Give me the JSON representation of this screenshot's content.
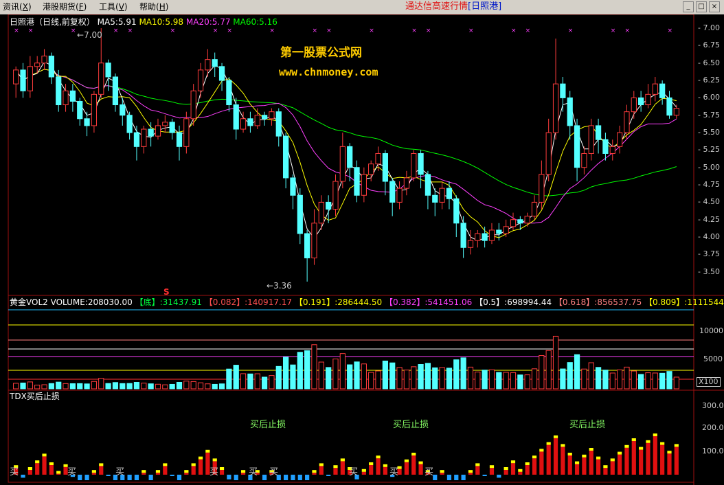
{
  "menu": {
    "items": [
      {
        "label": "资讯",
        "key": "X"
      },
      {
        "label": "港股期货",
        "key": "F"
      },
      {
        "label": "工具",
        "key": "V"
      },
      {
        "label": "帮助",
        "key": "H"
      }
    ],
    "title_red": "通达信高速行情",
    "title_blue": "[日照港]"
  },
  "main": {
    "stock_label": "日照港（日线,前复权）",
    "ma5": "MA5:5.91",
    "ma10": "MA10:5.98",
    "ma20": "MA20:5.77",
    "ma60": "MA60:5.16",
    "high_mark": "7.00",
    "low_mark": "3.36",
    "s_marker": "S",
    "watermark_title": "第一股票公式网",
    "watermark_url": "www.chnmoney.com",
    "y_axis": [
      "7.00",
      "6.75",
      "6.50",
      "6.25",
      "6.00",
      "5.75",
      "5.50",
      "5.25",
      "5.00",
      "4.75",
      "4.50",
      "4.25",
      "4.00",
      "3.75",
      "3.50"
    ],
    "y_min": 3.3,
    "y_max": 7.05
  },
  "volume": {
    "name": "黄金VOL2",
    "volume_label": "VOLUME:208030.00",
    "levels": [
      {
        "tag": "【底】",
        "value": ":31437.91",
        "color": "#00ff40"
      },
      {
        "tag": "【0.082】",
        "value": ":140917.17",
        "color": "#ff5050"
      },
      {
        "tag": "【0.191】",
        "value": ":286444.50",
        "color": "#ffff00"
      },
      {
        "tag": "【0.382】",
        "value": ":541451.06",
        "color": "#ff40ff"
      },
      {
        "tag": "【0.5】",
        "value": ":698994.44",
        "color": "#ffffff"
      },
      {
        "tag": "【0.618】",
        "value": ":856537.75",
        "color": "#ff8080"
      },
      {
        "tag": "【0.809】",
        "value": ":1111544.",
        "color": "#ffff00"
      }
    ],
    "y_axis": [
      "10000",
      "5000"
    ],
    "unit": "X100"
  },
  "indicator": {
    "name": "TDX买后止损",
    "y_axis": [
      "300.0",
      "200.0",
      "100.0"
    ],
    "notes": [
      "买后止损",
      "买后止损",
      "买后止损"
    ],
    "buy_label": "买"
  },
  "chart_data": {
    "type": "candlestick",
    "note": "Daily candles, approximate OHLC read from the price axis",
    "ylim": [
      3.3,
      7.05
    ],
    "candles": [
      [
        6.2,
        6.4,
        6.45,
        6.0
      ],
      [
        6.4,
        6.1,
        6.5,
        6.0
      ],
      [
        6.1,
        6.45,
        6.6,
        6.0
      ],
      [
        6.45,
        6.5,
        6.6,
        6.35
      ],
      [
        6.5,
        6.6,
        6.7,
        6.4
      ],
      [
        6.6,
        6.3,
        6.65,
        6.2
      ],
      [
        6.3,
        5.9,
        6.4,
        5.8
      ],
      [
        5.9,
        6.1,
        6.2,
        5.8
      ],
      [
        6.1,
        5.95,
        6.2,
        5.8
      ],
      [
        5.95,
        5.7,
        6.0,
        5.6
      ],
      [
        5.7,
        5.6,
        5.8,
        5.45
      ],
      [
        5.6,
        6.05,
        6.1,
        5.5
      ],
      [
        6.05,
        6.5,
        7.0,
        6.0
      ],
      [
        6.5,
        6.3,
        6.55,
        6.1
      ],
      [
        6.3,
        5.9,
        6.35,
        5.8
      ],
      [
        5.9,
        5.75,
        6.0,
        5.6
      ],
      [
        5.75,
        5.5,
        5.8,
        5.4
      ],
      [
        5.5,
        5.3,
        5.6,
        5.1
      ],
      [
        5.3,
        5.55,
        5.6,
        5.2
      ],
      [
        5.55,
        5.45,
        5.65,
        5.3
      ],
      [
        5.45,
        5.6,
        5.7,
        5.4
      ],
      [
        5.6,
        5.65,
        5.75,
        5.5
      ],
      [
        5.65,
        5.5,
        5.7,
        5.4
      ],
      [
        5.5,
        5.3,
        5.6,
        5.1
      ],
      [
        5.3,
        5.7,
        5.8,
        5.2
      ],
      [
        5.7,
        6.1,
        6.2,
        5.6
      ],
      [
        6.1,
        6.4,
        6.5,
        6.0
      ],
      [
        6.4,
        6.55,
        6.7,
        6.3
      ],
      [
        6.55,
        6.45,
        6.65,
        6.3
      ],
      [
        6.45,
        6.25,
        6.5,
        6.1
      ],
      [
        6.25,
        5.9,
        6.3,
        5.8
      ],
      [
        5.9,
        5.55,
        6.0,
        5.4
      ],
      [
        5.55,
        5.7,
        5.8,
        5.5
      ],
      [
        5.7,
        5.6,
        5.8,
        5.5
      ],
      [
        5.6,
        5.75,
        5.85,
        5.55
      ],
      [
        5.75,
        5.7,
        5.8,
        5.6
      ],
      [
        5.7,
        5.8,
        5.85,
        5.6
      ],
      [
        5.8,
        5.45,
        5.85,
        5.3
      ],
      [
        5.45,
        4.85,
        5.5,
        4.7
      ],
      [
        4.85,
        4.6,
        4.9,
        4.4
      ],
      [
        4.6,
        4.05,
        4.7,
        3.9
      ],
      [
        4.05,
        3.7,
        4.1,
        3.36
      ],
      [
        3.7,
        4.2,
        4.4,
        3.6
      ],
      [
        4.2,
        4.5,
        4.6,
        4.1
      ],
      [
        4.5,
        4.4,
        4.6,
        4.2
      ],
      [
        4.4,
        4.8,
        4.9,
        4.3
      ],
      [
        4.8,
        5.3,
        5.5,
        4.7
      ],
      [
        5.3,
        5.0,
        5.35,
        4.8
      ],
      [
        5.0,
        4.6,
        5.1,
        4.5
      ],
      [
        4.6,
        4.9,
        5.0,
        4.5
      ],
      [
        4.9,
        5.05,
        5.1,
        4.8
      ],
      [
        5.05,
        5.2,
        5.3,
        4.95
      ],
      [
        5.2,
        4.8,
        5.25,
        4.6
      ],
      [
        4.8,
        4.5,
        4.85,
        4.3
      ],
      [
        4.5,
        4.7,
        4.8,
        4.4
      ],
      [
        4.7,
        4.85,
        4.95,
        4.6
      ],
      [
        4.85,
        5.2,
        5.25,
        4.8
      ],
      [
        5.2,
        4.9,
        5.25,
        4.7
      ],
      [
        4.9,
        4.6,
        4.95,
        4.4
      ],
      [
        4.6,
        4.5,
        4.7,
        4.3
      ],
      [
        4.5,
        4.7,
        4.8,
        4.4
      ],
      [
        4.7,
        4.55,
        4.8,
        4.4
      ],
      [
        4.55,
        4.2,
        4.6,
        4.0
      ],
      [
        4.2,
        3.85,
        4.3,
        3.7
      ],
      [
        3.85,
        3.95,
        4.1,
        3.75
      ],
      [
        3.95,
        4.05,
        4.1,
        3.85
      ],
      [
        4.05,
        3.95,
        4.15,
        3.85
      ],
      [
        3.95,
        4.1,
        4.2,
        3.9
      ],
      [
        4.1,
        4.05,
        4.2,
        3.95
      ],
      [
        4.05,
        4.15,
        4.25,
        4.0
      ],
      [
        4.15,
        4.25,
        4.35,
        4.1
      ],
      [
        4.25,
        4.2,
        4.3,
        4.1
      ],
      [
        4.2,
        4.3,
        4.35,
        4.15
      ],
      [
        4.3,
        4.5,
        4.6,
        4.25
      ],
      [
        4.5,
        4.9,
        5.1,
        4.4
      ],
      [
        4.9,
        5.5,
        5.7,
        4.8
      ],
      [
        5.5,
        6.2,
        6.85,
        5.4
      ],
      [
        6.2,
        6.0,
        6.3,
        5.8
      ],
      [
        6.0,
        5.6,
        6.1,
        5.4
      ],
      [
        5.6,
        5.0,
        5.7,
        4.8
      ],
      [
        5.0,
        5.2,
        5.3,
        4.9
      ],
      [
        5.2,
        5.6,
        5.7,
        5.1
      ],
      [
        5.6,
        5.4,
        5.7,
        5.2
      ],
      [
        5.4,
        5.2,
        5.5,
        5.1
      ],
      [
        5.2,
        5.3,
        5.4,
        5.1
      ],
      [
        5.3,
        5.5,
        5.6,
        5.2
      ],
      [
        5.5,
        5.8,
        5.9,
        5.4
      ],
      [
        5.8,
        6.0,
        6.1,
        5.7
      ],
      [
        6.0,
        5.9,
        6.1,
        5.8
      ],
      [
        5.9,
        6.05,
        6.2,
        5.85
      ],
      [
        6.05,
        6.2,
        6.3,
        5.95
      ],
      [
        6.2,
        6.0,
        6.25,
        5.9
      ],
      [
        6.0,
        5.75,
        6.1,
        5.7
      ],
      [
        5.75,
        5.85,
        5.9,
        5.7
      ]
    ]
  }
}
